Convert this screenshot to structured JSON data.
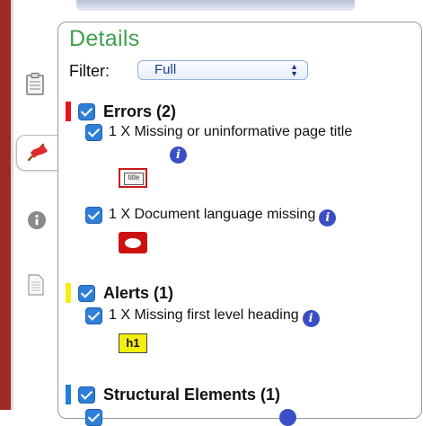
{
  "panel": {
    "title": "Details",
    "filter_label": "Filter:",
    "filter_value": "Full"
  },
  "sections": {
    "errors": {
      "title": "Errors (2)",
      "color": "#e8141c",
      "items": [
        {
          "text": "1 X Missing or uninformative page title",
          "badge": "title",
          "badge_text": "title"
        },
        {
          "text": "1 X Document language missing",
          "badge": "speech-bubble-icon"
        }
      ]
    },
    "alerts": {
      "title": "Alerts (1)",
      "color": "#f5ee10",
      "items": [
        {
          "text": "1 X Missing first level heading",
          "badge": "h1",
          "badge_text": "h1"
        }
      ]
    },
    "structural": {
      "title": "Structural Elements (1)",
      "color": "#1f7ed8"
    }
  },
  "sidebar": {
    "icons": [
      "clipboard-icon",
      "flag-icon",
      "info-icon",
      "document-icon"
    ]
  },
  "info_glyph": "i"
}
